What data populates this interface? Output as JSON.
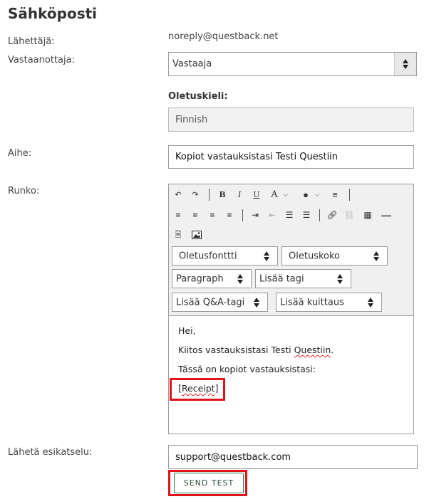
{
  "page": {
    "title": "Sähköposti"
  },
  "sender": {
    "label": "Lähettäjä:",
    "value": "noreply@questback.net"
  },
  "recipient": {
    "label": "Vastaanottaja:",
    "selected": "Vastaaja"
  },
  "language": {
    "label": "Oletuskieli:",
    "value": "Finnish"
  },
  "subject": {
    "label": "Aihe:",
    "value": "Kopiot vastauksistasi Testi Questiin"
  },
  "body": {
    "label": "Runko:",
    "toolbar": {
      "undo": "↶",
      "redo": "↷",
      "bold": "B",
      "italic": "I",
      "underline": "U",
      "font_color": "A",
      "bg_color": "●",
      "clear": "≡",
      "font_select": "Oletusfonttti",
      "size_select": "Oletuskoko",
      "format_select": "Paragraph",
      "tag_select": "Lisää tagi",
      "qa_tag_select": "Lisää Q&A-tagi",
      "receipt_select": "Lisää kuittaus"
    },
    "lines": {
      "greeting": "Hei,",
      "thanks_prefix": "Kiitos vastauksistasi Testi ",
      "thanks_word": "Questiin",
      "thanks_suffix": ".",
      "copies": "Tässä on kopiot vastauksistasi:",
      "receipt_open": "[",
      "receipt_word": "Receipt",
      "receipt_close": "]"
    }
  },
  "preview": {
    "label": "Lähetä esikatselu:",
    "value": "support@questback.com",
    "button": "SEND TEST"
  },
  "colors": {
    "highlight": "#e0131a",
    "button_border": "#2e7d4e"
  }
}
